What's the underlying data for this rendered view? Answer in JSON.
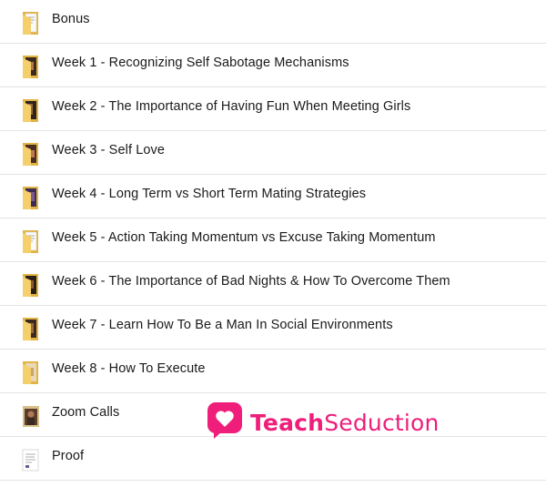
{
  "folders": [
    {
      "label": "Bonus",
      "icon": "folder-icon"
    },
    {
      "label": "Week 1 - Recognizing Self Sabotage Mechanisms",
      "icon": "folder-icon"
    },
    {
      "label": "Week 2 - The Importance of Having Fun When Meeting Girls",
      "icon": "folder-icon"
    },
    {
      "label": "Week 3 - Self Love",
      "icon": "folder-icon"
    },
    {
      "label": "Week 4 - Long Term vs Short Term Mating Strategies",
      "icon": "folder-icon"
    },
    {
      "label": "Week 5 - Action Taking Momentum vs Excuse Taking Momentum",
      "icon": "folder-icon"
    },
    {
      "label": "Week 6 - The Importance of Bad Nights & How To Overcome Them",
      "icon": "folder-icon"
    },
    {
      "label": "Week 7 - Learn How To Be a Man In Social Environments",
      "icon": "folder-icon"
    },
    {
      "label": "Week 8 - How To Execute",
      "icon": "folder-icon"
    },
    {
      "label": "Zoom Calls",
      "icon": "image-thumbnail-icon"
    },
    {
      "label": "Proof",
      "icon": "document-thumbnail-icon"
    }
  ],
  "watermark": {
    "text_bold": "Teach",
    "text_regular": "Seduction",
    "color": "#ee1e7a"
  },
  "colors": {
    "folder": "#f5cf6b",
    "folder_dark": "#e2b444",
    "divider": "#e3e3e3"
  }
}
